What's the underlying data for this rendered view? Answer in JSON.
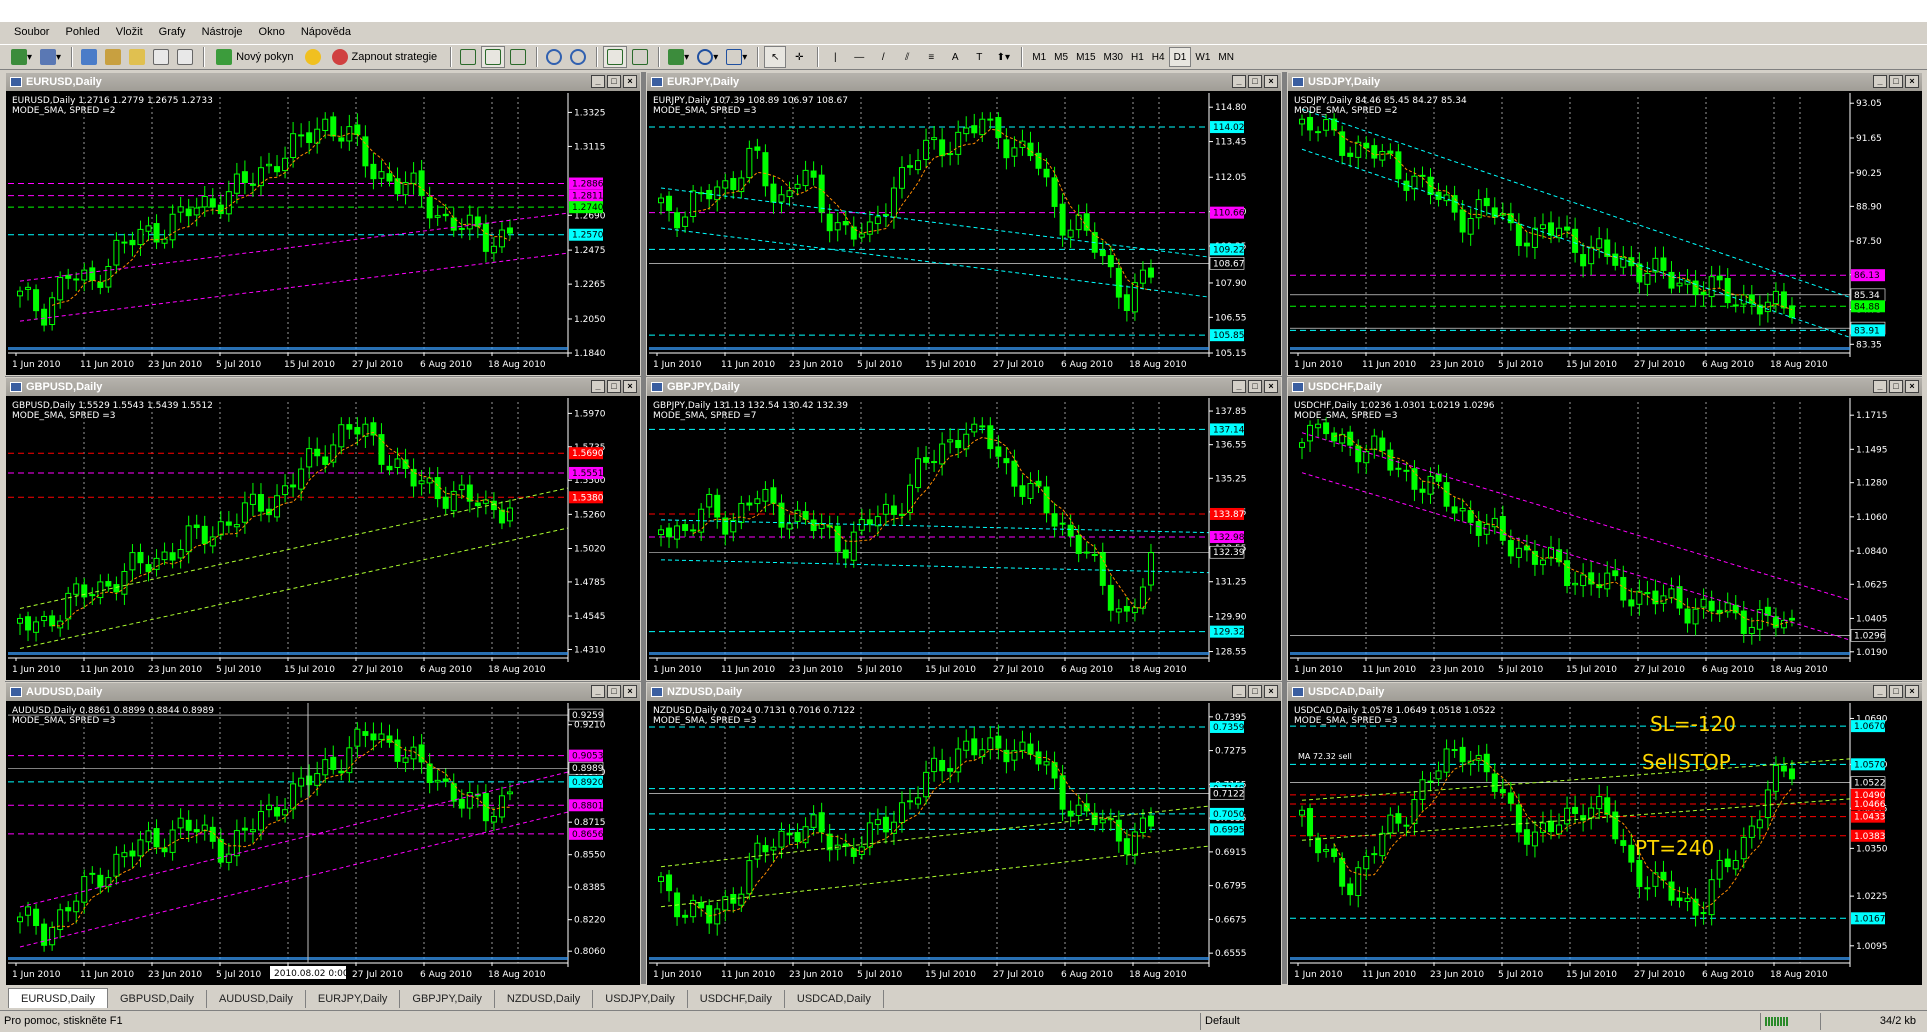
{
  "menu": [
    "Soubor",
    "Pohled",
    "Vložit",
    "Grafy",
    "Nástroje",
    "Okno",
    "Nápověda"
  ],
  "toolbar": {
    "new_order": "Nový pokyn",
    "start_strategies": "Zapnout strategie",
    "line_tools": [
      "|",
      "/",
      "A",
      "T"
    ],
    "timeframes": [
      "M1",
      "M5",
      "M15",
      "M30",
      "H1",
      "H4",
      "D1",
      "W1",
      "MN"
    ],
    "active_timeframe": "D1"
  },
  "dates_common": [
    "1 Jun 2010",
    "11 Jun 2010",
    "23 Jun 2010",
    "5 Jul 2010",
    "15 Jul 2010",
    "27 Jul 2010",
    "6 Aug 2010",
    "18 Aug 2010"
  ],
  "charts": [
    {
      "title": "EURUSD,Daily",
      "info1": "EURUSD,Daily  1.2716 1.2779 1.2675 1.2733",
      "info2": "MODE_SMA, SPRED =2",
      "prices": [
        "1.3325",
        "1.3115",
        "1.2690",
        "1.2475",
        "1.2265",
        "1.2050",
        "1.1840"
      ],
      "tags": [
        {
          "text": "1.2886",
          "color": "#ff00ff"
        },
        {
          "text": "1.2811",
          "color": "#ff00ff"
        },
        {
          "text": "1.2740",
          "color": "#00ff00"
        },
        {
          "text": "1.2570",
          "color": "#00ffff"
        }
      ],
      "ymin": 1.184,
      "ymax": 1.342,
      "pattern": [
        0.2,
        0.15,
        0.3,
        0.25,
        0.4,
        0.45,
        0.5,
        0.55,
        0.6,
        0.65,
        0.7,
        0.8,
        0.85,
        0.95,
        0.9,
        0.75,
        0.7,
        0.65,
        0.55,
        0.5,
        0.45,
        0.48
      ]
    },
    {
      "title": "EURJPY,Daily",
      "info1": "EURJPY,Daily  107.39 108.89 106.97 108.67",
      "info2": "MODE_SMA, SPRED =3",
      "prices": [
        "114.80",
        "113.45",
        "112.05",
        "110.70",
        "109.35",
        "107.90",
        "106.55",
        "105.15"
      ],
      "tags": [
        {
          "text": "114.02",
          "color": "#00ffff"
        },
        {
          "text": "110.66",
          "color": "#ff00ff"
        },
        {
          "text": "109.22",
          "color": "#00ffff"
        },
        {
          "text": "108.67",
          "color": "#ffffff"
        },
        {
          "text": "105.85",
          "color": "#00ffff"
        }
      ],
      "ymin": 105.15,
      "ymax": 115.2,
      "pattern": [
        0.6,
        0.55,
        0.65,
        0.7,
        0.8,
        0.6,
        0.75,
        0.55,
        0.5,
        0.45,
        0.7,
        0.8,
        0.85,
        0.9,
        0.95,
        0.85,
        0.8,
        0.55,
        0.5,
        0.35,
        0.2,
        0.3
      ]
    },
    {
      "title": "USDJPY,Daily",
      "info1": "USDJPY,Daily  84.46 85.45 84.27 85.34",
      "info2": "MODE_SMA, SPRED =2",
      "prices": [
        "93.05",
        "91.65",
        "90.25",
        "88.90",
        "87.50",
        "86.15",
        "84.75",
        "83.35"
      ],
      "tags": [
        {
          "text": "86.13",
          "color": "#ff00ff"
        },
        {
          "text": "85.34",
          "color": "#ffffff"
        },
        {
          "text": "84.88",
          "color": "#00ff00"
        },
        {
          "text": "84.00",
          "color": "#ffffff"
        },
        {
          "text": "83.91",
          "color": "#00ffff"
        }
      ],
      "ymin": 83.0,
      "ymax": 93.3,
      "pattern": [
        0.95,
        0.9,
        0.85,
        0.82,
        0.75,
        0.7,
        0.6,
        0.55,
        0.58,
        0.5,
        0.45,
        0.5,
        0.4,
        0.38,
        0.35,
        0.3,
        0.28,
        0.25,
        0.22,
        0.2,
        0.15,
        0.18
      ]
    },
    {
      "title": "GBPUSD,Daily",
      "info1": "GBPUSD,Daily  1.5529 1.5543 1.5439 1.5512",
      "info2": "MODE_SMA, SPRED =3",
      "prices": [
        "1.5970",
        "1.5735",
        "1.5500",
        "1.5260",
        "1.5020",
        "1.4785",
        "1.4545",
        "1.4310"
      ],
      "tags": [
        {
          "text": "1.5690",
          "color": "#ff0000"
        },
        {
          "text": "1.5551",
          "color": "#ff00ff"
        },
        {
          "text": "1.5380",
          "color": "#ff0000"
        }
      ],
      "ymin": 1.425,
      "ymax": 1.605,
      "pattern": [
        0.1,
        0.12,
        0.2,
        0.25,
        0.3,
        0.35,
        0.4,
        0.45,
        0.5,
        0.55,
        0.6,
        0.65,
        0.75,
        0.85,
        0.95,
        0.9,
        0.8,
        0.7,
        0.68,
        0.65,
        0.6,
        0.62
      ]
    },
    {
      "title": "GBPJPY,Daily",
      "info1": "GBPJPY,Daily  131.13 132.54 130.42 132.39",
      "info2": "MODE_SMA, SPRED =7",
      "prices": [
        "137.85",
        "136.55",
        "135.25",
        "133.95",
        "132.55",
        "131.25",
        "129.90",
        "128.55"
      ],
      "tags": [
        {
          "text": "137.14",
          "color": "#00ffff"
        },
        {
          "text": "133.87",
          "color": "#ff0000"
        },
        {
          "text": "132.98",
          "color": "#ff00ff"
        },
        {
          "text": "132.39",
          "color": "#ffffff"
        },
        {
          "text": "129.32",
          "color": "#00ffff"
        }
      ],
      "ymin": 128.3,
      "ymax": 138.2,
      "pattern": [
        0.55,
        0.5,
        0.6,
        0.55,
        0.65,
        0.6,
        0.55,
        0.5,
        0.45,
        0.55,
        0.6,
        0.75,
        0.85,
        0.95,
        0.9,
        0.75,
        0.65,
        0.55,
        0.45,
        0.25,
        0.15,
        0.35
      ]
    },
    {
      "title": "USDCHF,Daily",
      "info1": "USDCHF,Daily  1.0236 1.0301 1.0219 1.0296",
      "info2": "MODE_SMA, SPRED =3",
      "prices": [
        "1.1715",
        "1.1495",
        "1.1280",
        "1.1060",
        "1.0840",
        "1.0625",
        "1.0405",
        "1.0190"
      ],
      "tags": [
        {
          "text": "1.0296",
          "color": "#ffffff"
        }
      ],
      "ymin": 1.015,
      "ymax": 1.18,
      "pattern": [
        0.95,
        0.92,
        0.88,
        0.85,
        0.78,
        0.72,
        0.65,
        0.58,
        0.5,
        0.45,
        0.4,
        0.35,
        0.3,
        0.28,
        0.25,
        0.22,
        0.2,
        0.18,
        0.16,
        0.14,
        0.12,
        0.1
      ]
    },
    {
      "title": "AUDUSD,Daily",
      "info1": "AUDUSD,Daily  0.8861 0.8899 0.8844 0.8989",
      "info2": "MODE_SMA, SPRED =3",
      "prices": [
        "0.9210",
        "0.8970",
        "0.8715",
        "0.8550",
        "0.8385",
        "0.8220",
        "0.8060"
      ],
      "tags": [
        {
          "text": "0.9259",
          "color": "#ffffff"
        },
        {
          "text": "0.9053",
          "color": "#ff00ff"
        },
        {
          "text": "0.8989",
          "color": "#ffffff"
        },
        {
          "text": "0.8920",
          "color": "#00ffff"
        },
        {
          "text": "0.8801",
          "color": "#ff00ff"
        },
        {
          "text": "0.8656",
          "color": "#ff00ff"
        }
      ],
      "ymin": 0.8,
      "ymax": 0.93,
      "pattern": [
        0.15,
        0.1,
        0.2,
        0.3,
        0.4,
        0.45,
        0.5,
        0.55,
        0.5,
        0.45,
        0.55,
        0.65,
        0.7,
        0.8,
        0.85,
        0.95,
        0.9,
        0.8,
        0.75,
        0.65,
        0.6,
        0.7
      ],
      "crosshair": "2010.08.02 0:00"
    },
    {
      "title": "NZDUSD,Daily",
      "info1": "NZDUSD,Daily  0.7024 0.7131 0.7016 0.7122",
      "info2": "MODE_SMA, SPRED =3",
      "prices": [
        "0.7395",
        "0.7275",
        "0.7155",
        "0.7035",
        "0.6915",
        "0.6795",
        "0.6675",
        "0.6555"
      ],
      "tags": [
        {
          "text": "0.7359",
          "color": "#00ffff"
        },
        {
          "text": "0.7140",
          "color": "#00ffff"
        },
        {
          "text": "0.7122",
          "color": "#ffffff"
        },
        {
          "text": "0.7050",
          "color": "#00ffff"
        },
        {
          "text": "0.6995",
          "color": "#00ffff"
        }
      ],
      "ymin": 0.652,
      "ymax": 0.743,
      "pattern": [
        0.3,
        0.2,
        0.15,
        0.25,
        0.4,
        0.5,
        0.55,
        0.5,
        0.45,
        0.5,
        0.6,
        0.7,
        0.8,
        0.9,
        0.85,
        0.9,
        0.85,
        0.7,
        0.6,
        0.55,
        0.5,
        0.55
      ]
    },
    {
      "title": "USDCAD,Daily",
      "info1": "USDCAD,Daily  1.0578 1.0649 1.0518 1.0522",
      "info2": "MODE_SMA, SPRED =3",
      "prices": [
        "1.0690",
        "1.0570",
        "1.0455",
        "1.0350",
        "1.0225",
        "1.0095"
      ],
      "tags": [
        {
          "text": "1.0670",
          "color": "#00ffff"
        },
        {
          "text": "1.0570",
          "color": "#00ffff"
        },
        {
          "text": "1.0522",
          "color": "#ffffff"
        },
        {
          "text": "1.0490",
          "color": "#ff0000"
        },
        {
          "text": "1.0466",
          "color": "#ff0000"
        },
        {
          "text": "1.0433",
          "color": "#ff0000"
        },
        {
          "text": "1.0383",
          "color": "#ff0000"
        },
        {
          "text": "1.0167",
          "color": "#00ffff"
        }
      ],
      "ymin": 1.005,
      "ymax": 1.072,
      "pattern": [
        0.6,
        0.4,
        0.3,
        0.45,
        0.55,
        0.7,
        0.8,
        0.9,
        0.75,
        0.6,
        0.5,
        0.55,
        0.65,
        0.6,
        0.4,
        0.3,
        0.25,
        0.2,
        0.35,
        0.5,
        0.7,
        0.8
      ],
      "annotations": {
        "sl": "SL=-120",
        "sellstop": "SellSTOP",
        "pt": "PT=240",
        "mark": "MA 72.32 sell"
      }
    }
  ],
  "symbol_tabs": [
    "EURUSD,Daily",
    "GBPUSD,Daily",
    "AUDUSD,Daily",
    "EURJPY,Daily",
    "GBPJPY,Daily",
    "NZDUSD,Daily",
    "USDJPY,Daily",
    "USDCHF,Daily",
    "USDCAD,Daily"
  ],
  "status": {
    "help": "Pro pomoc, stiskněte F1",
    "profile": "Default",
    "traffic": "34/2 kb"
  }
}
